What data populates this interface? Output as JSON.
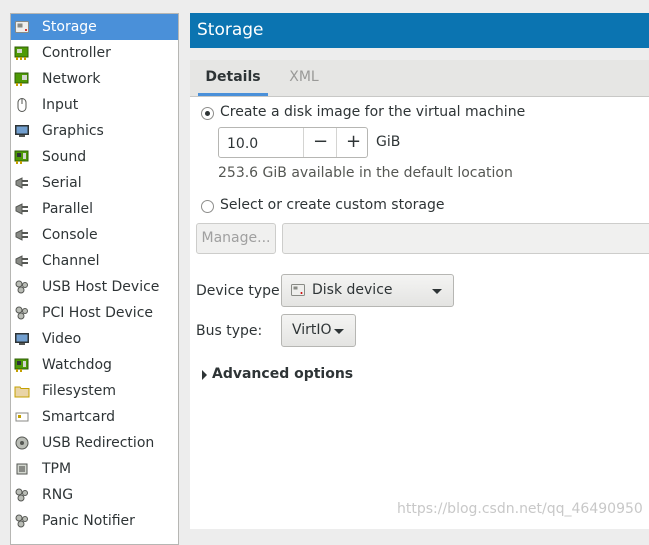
{
  "sidebar": {
    "items": [
      {
        "label": "Storage",
        "icon": "storage-icon",
        "selected": true
      },
      {
        "label": "Controller",
        "icon": "controller-icon"
      },
      {
        "label": "Network",
        "icon": "network-icon"
      },
      {
        "label": "Input",
        "icon": "mouse-icon"
      },
      {
        "label": "Graphics",
        "icon": "monitor-icon"
      },
      {
        "label": "Sound",
        "icon": "sound-card-icon"
      },
      {
        "label": "Serial",
        "icon": "serial-plug-icon"
      },
      {
        "label": "Parallel",
        "icon": "parallel-plug-icon"
      },
      {
        "label": "Console",
        "icon": "console-plug-icon"
      },
      {
        "label": "Channel",
        "icon": "channel-plug-icon"
      },
      {
        "label": "USB Host Device",
        "icon": "usb-device-icon"
      },
      {
        "label": "PCI Host Device",
        "icon": "pci-device-icon"
      },
      {
        "label": "Video",
        "icon": "video-monitor-icon"
      },
      {
        "label": "Watchdog",
        "icon": "watchdog-icon"
      },
      {
        "label": "Filesystem",
        "icon": "folder-icon"
      },
      {
        "label": "Smartcard",
        "icon": "smartcard-icon"
      },
      {
        "label": "USB Redirection",
        "icon": "usb-redirection-icon"
      },
      {
        "label": "TPM",
        "icon": "tpm-chip-icon"
      },
      {
        "label": "RNG",
        "icon": "rng-icon"
      },
      {
        "label": "Panic Notifier",
        "icon": "panic-notifier-icon"
      }
    ]
  },
  "header": {
    "title": "Storage"
  },
  "tabs": [
    {
      "label": "Details",
      "active": true
    },
    {
      "label": "XML",
      "active": false
    }
  ],
  "storage": {
    "create_option_label": "Create a disk image for the virtual machine",
    "size_value": "10.0",
    "size_unit": "GiB",
    "minus": "−",
    "plus": "+",
    "available_text": "253.6 GiB available in the default location",
    "custom_option_label": "Select or create custom storage",
    "manage_label": "Manage...",
    "custom_path_value": ""
  },
  "device": {
    "device_type_label": "Device type:",
    "device_type_value": "Disk device",
    "bus_type_label": "Bus type:",
    "bus_type_value": "VirtIO"
  },
  "advanced": {
    "label": "Advanced options"
  },
  "watermark": "https://blog.csdn.net/qq_46490950",
  "colors": {
    "selection": "#4a90d9",
    "header_bg": "#0b74b1",
    "watermark": "#c8c8c8"
  }
}
